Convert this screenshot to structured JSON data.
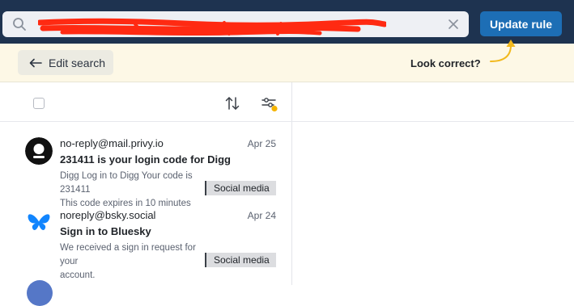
{
  "toolbar": {
    "search": {
      "value": "",
      "icon": "search-icon",
      "clear_icon": "close-icon"
    },
    "update_label": "Update rule"
  },
  "hint": {
    "edit_search_label": "Edit search",
    "look_correct": "Look correct?"
  },
  "list": {
    "items": [
      {
        "from": "no-reply@mail.privy.io",
        "date": "Apr 25",
        "subject": "231411 is your login code for Digg",
        "preview_line1": "Digg Log in to Digg Your code is 231411",
        "preview_line2": "This code expires in 10 minutes",
        "tag": "Social media",
        "avatar": "privy-logo"
      },
      {
        "from": "noreply@bsky.social",
        "date": "Apr 24",
        "subject": "Sign in to Bluesky",
        "preview_line1": "We received a sign in request for your",
        "preview_line2": "account.",
        "tag": "Social media",
        "avatar": "bluesky-logo"
      }
    ]
  },
  "colors": {
    "topbar": "#1e3350",
    "update_button": "#1d6eb5",
    "hint_background": "#fdf8e6",
    "hint_arrow": "#f2b91d",
    "filter_dot": "#f5b400",
    "bluesky": "#1185fe"
  }
}
